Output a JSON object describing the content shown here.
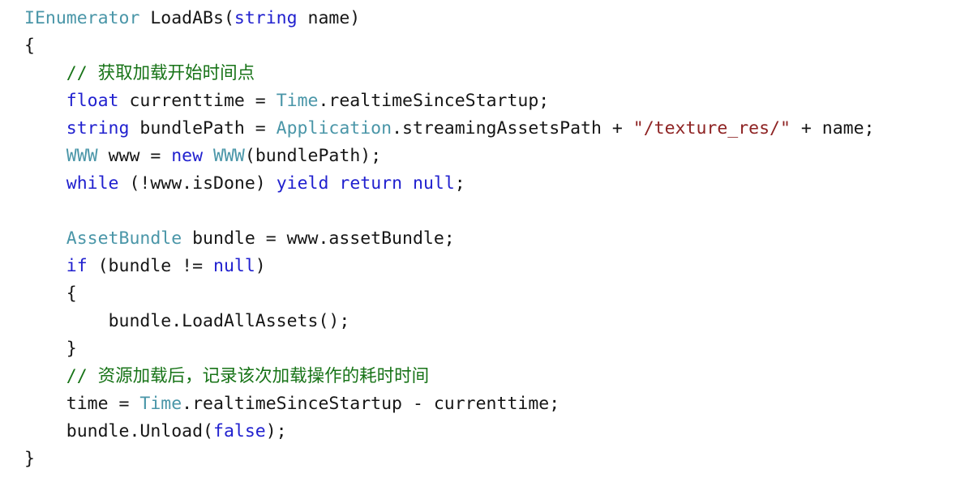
{
  "view": {
    "kind": "code-snippet",
    "language": "C#",
    "background_color": "#ffffff",
    "font_size_px": 21.5,
    "line_height_px": 34
  },
  "theme": {
    "type_color": "#4a96a8",
    "keyword_color": "#2121cf",
    "comment_color": "#177317",
    "string_color": "#8e2323",
    "plain_color": "#161616"
  },
  "code": {
    "lines": [
      {
        "indent": 0,
        "tokens": [
          {
            "text": "IEnumerator",
            "kind": "type"
          },
          {
            "text": " LoadABs(",
            "kind": "plain"
          },
          {
            "text": "string",
            "kind": "keyword"
          },
          {
            "text": " name)",
            "kind": "plain"
          }
        ]
      },
      {
        "indent": 0,
        "tokens": [
          {
            "text": "{",
            "kind": "plain"
          }
        ]
      },
      {
        "indent": 1,
        "tokens": [
          {
            "text": "// 获取加载开始时间点",
            "kind": "comment"
          }
        ]
      },
      {
        "indent": 1,
        "tokens": [
          {
            "text": "float",
            "kind": "keyword"
          },
          {
            "text": " currenttime = ",
            "kind": "plain"
          },
          {
            "text": "Time",
            "kind": "type"
          },
          {
            "text": ".realtimeSinceStartup;",
            "kind": "plain"
          }
        ]
      },
      {
        "indent": 1,
        "tokens": [
          {
            "text": "string",
            "kind": "keyword"
          },
          {
            "text": " bundlePath = ",
            "kind": "plain"
          },
          {
            "text": "Application",
            "kind": "type"
          },
          {
            "text": ".streamingAssetsPath + ",
            "kind": "plain"
          },
          {
            "text": "\"/texture_res/\"",
            "kind": "string"
          },
          {
            "text": " + name;",
            "kind": "plain"
          }
        ]
      },
      {
        "indent": 1,
        "tokens": [
          {
            "text": "WWW",
            "kind": "type"
          },
          {
            "text": " www = ",
            "kind": "plain"
          },
          {
            "text": "new",
            "kind": "keyword"
          },
          {
            "text": " ",
            "kind": "plain"
          },
          {
            "text": "WWW",
            "kind": "type"
          },
          {
            "text": "(bundlePath);",
            "kind": "plain"
          }
        ]
      },
      {
        "indent": 1,
        "tokens": [
          {
            "text": "while",
            "kind": "keyword"
          },
          {
            "text": " (!www.isDone) ",
            "kind": "plain"
          },
          {
            "text": "yield",
            "kind": "keyword"
          },
          {
            "text": " ",
            "kind": "plain"
          },
          {
            "text": "return",
            "kind": "keyword"
          },
          {
            "text": " ",
            "kind": "plain"
          },
          {
            "text": "null",
            "kind": "keyword"
          },
          {
            "text": ";",
            "kind": "plain"
          }
        ]
      },
      {
        "indent": 0,
        "tokens": []
      },
      {
        "indent": 1,
        "tokens": [
          {
            "text": "AssetBundle",
            "kind": "type"
          },
          {
            "text": " bundle = www.assetBundle;",
            "kind": "plain"
          }
        ]
      },
      {
        "indent": 1,
        "tokens": [
          {
            "text": "if",
            "kind": "keyword"
          },
          {
            "text": " (bundle != ",
            "kind": "plain"
          },
          {
            "text": "null",
            "kind": "keyword"
          },
          {
            "text": ")",
            "kind": "plain"
          }
        ]
      },
      {
        "indent": 1,
        "tokens": [
          {
            "text": "{",
            "kind": "plain"
          }
        ]
      },
      {
        "indent": 2,
        "tokens": [
          {
            "text": "bundle.LoadAllAssets();",
            "kind": "plain"
          }
        ]
      },
      {
        "indent": 1,
        "tokens": [
          {
            "text": "}",
            "kind": "plain"
          }
        ]
      },
      {
        "indent": 1,
        "tokens": [
          {
            "text": "// 资源加载后，记录该次加载操作的耗时时间",
            "kind": "comment"
          }
        ]
      },
      {
        "indent": 1,
        "tokens": [
          {
            "text": "time = ",
            "kind": "plain"
          },
          {
            "text": "Time",
            "kind": "type"
          },
          {
            "text": ".realtimeSinceStartup - currenttime;",
            "kind": "plain"
          }
        ]
      },
      {
        "indent": 1,
        "tokens": [
          {
            "text": "bundle.Unload(",
            "kind": "plain"
          },
          {
            "text": "false",
            "kind": "keyword"
          },
          {
            "text": ");",
            "kind": "plain"
          }
        ]
      },
      {
        "indent": 0,
        "tokens": [
          {
            "text": "}",
            "kind": "plain"
          }
        ]
      }
    ]
  }
}
